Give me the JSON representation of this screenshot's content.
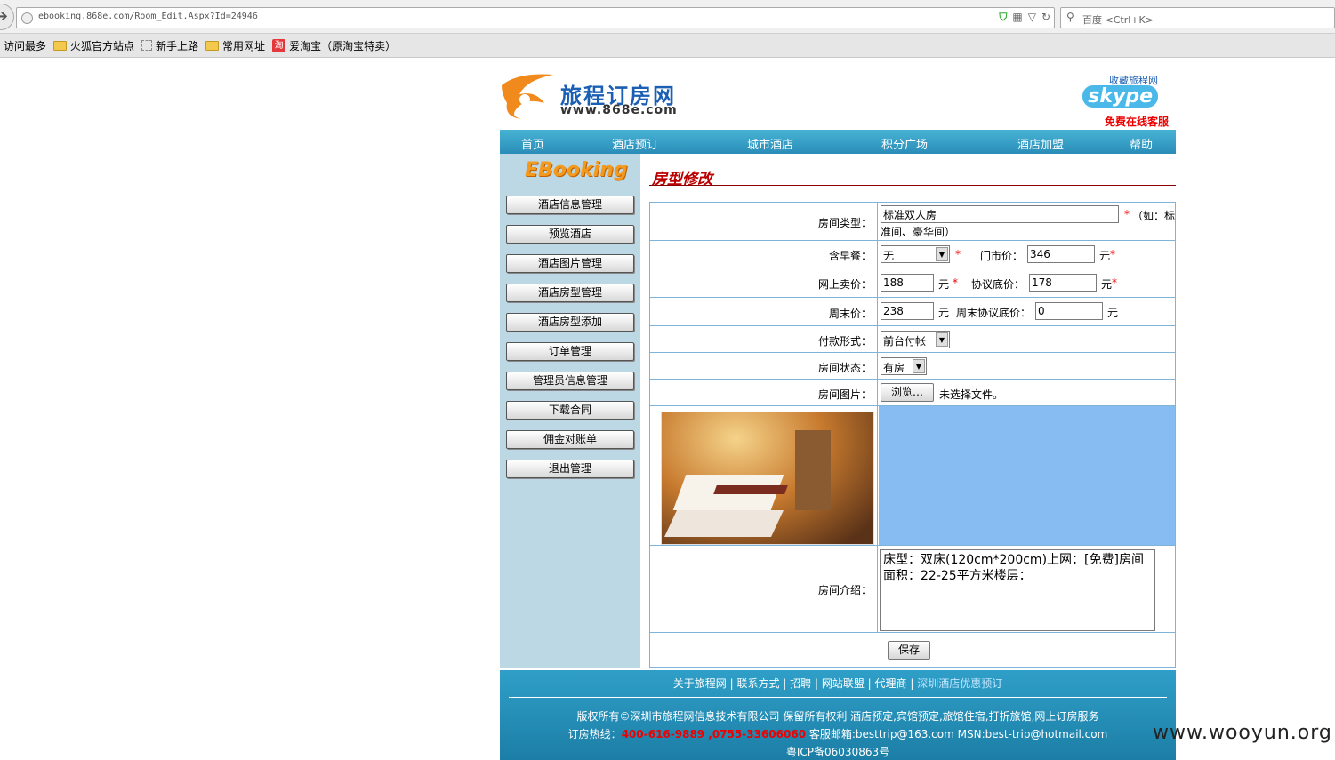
{
  "browser": {
    "url": "ebooking.868e.com/Room_Edit.Aspx?Id=24946",
    "search_placeholder": "百度 <Ctrl+K>",
    "bookmarks": [
      "访问最多",
      "火狐官方站点",
      "新手上路",
      "常用网址",
      "爱淘宝（原淘宝特卖）"
    ]
  },
  "header": {
    "logo_cn": "旅程订房网",
    "logo_url": "www.868e.com",
    "favorite": "收藏旅程网",
    "skype": "skype",
    "online_service": "免费在线客服"
  },
  "nav": [
    "首页",
    "酒店预订",
    "城市酒店",
    "积分广场",
    "酒店加盟",
    "帮助"
  ],
  "sidebar": {
    "title": "EBooking",
    "items": [
      "酒店信息管理",
      "预览酒店",
      "酒店图片管理",
      "酒店房型管理",
      "酒店房型添加",
      "订单管理",
      "管理员信息管理",
      "下载合同",
      "佣金对账单",
      "退出管理"
    ]
  },
  "page_title": "房型修改",
  "form": {
    "room_type_label": "房间类型：",
    "room_type_value": "标准双人房",
    "room_type_hint_1": "（如：标",
    "room_type_hint_2": "准间、豪华间）",
    "breakfast_label": "含早餐：",
    "breakfast_value": "无",
    "door_price_label": "门市价：",
    "door_price_value": "346",
    "online_price_label": "网上卖价：",
    "online_price_value": "188",
    "agreement_price_label": "协议底价：",
    "agreement_price_value": "178",
    "weekend_price_label": "周末价：",
    "weekend_price_value": "238",
    "weekend_agreement_label": "周末协议底价：",
    "weekend_agreement_value": "0",
    "payment_label": "付款形式：",
    "payment_value": "前台付帐",
    "status_label": "房间状态：",
    "status_value": "有房",
    "image_label": "房间图片：",
    "browse_button": "浏览…",
    "no_file": "未选择文件。",
    "intro_label": "房间介绍：",
    "intro_value": "床型：双床(120cm*200cm)上网：[免费]房间面积：22-25平方米楼层：",
    "yuan": "元",
    "required": "*",
    "save_button": "保存"
  },
  "footer": {
    "links": [
      "关于旅程网",
      "联系方式",
      "招聘",
      "网站联盟",
      "代理商",
      "深圳酒店优惠预订"
    ],
    "copyright": "版权所有©深圳市旅程网信息技术有限公司 保留所有权利   酒店预定,宾馆预定,旅馆住宿,打折旅馆,网上订房服务",
    "hotline_label": "订房热线：",
    "hotline_numbers": "400-616-9889 ,0755-33606060",
    "contact_rest": " 客服邮箱:besttrip@163.com MSN:best-trip@hotmail.com",
    "icp": "粤ICP备06030863号"
  },
  "watermark": "www.wooyun.org"
}
